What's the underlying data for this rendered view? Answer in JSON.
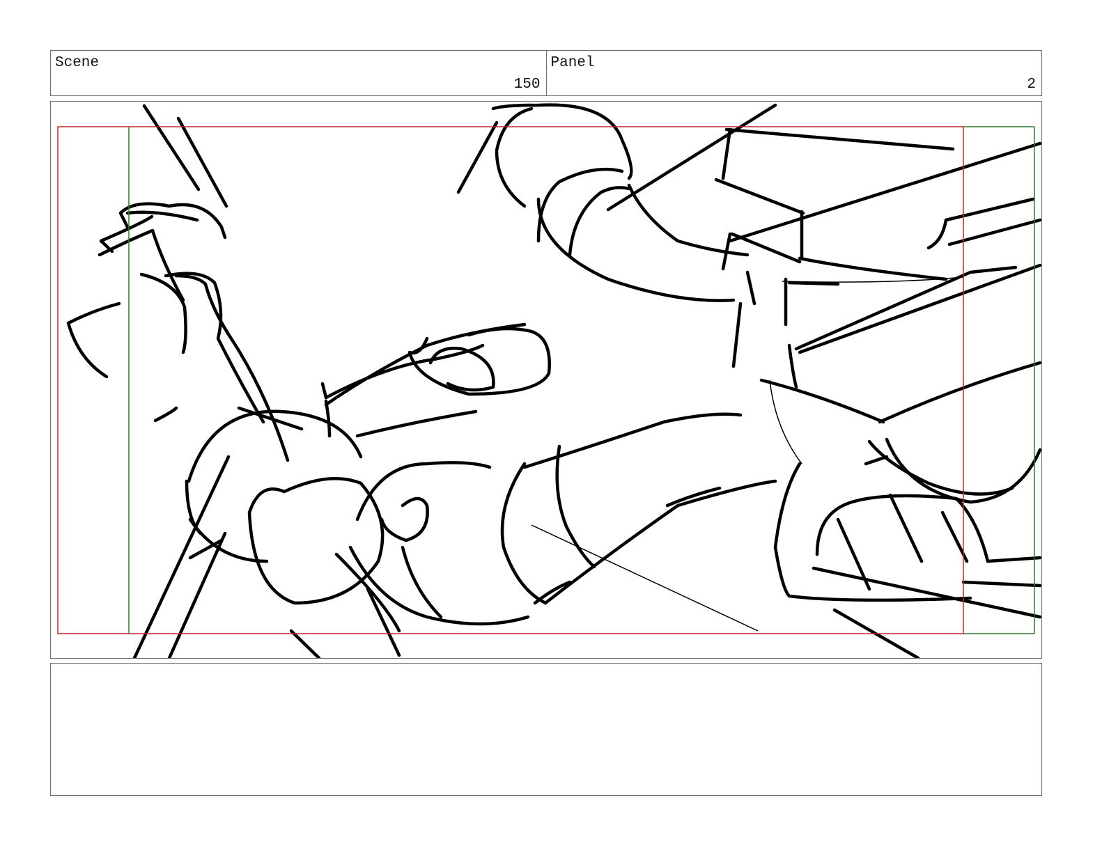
{
  "header": {
    "scene": {
      "label": "Scene",
      "value": "150"
    },
    "panel": {
      "label": "Panel",
      "value": "2"
    }
  },
  "frame": {
    "safe_area_color": "#c0282d",
    "action_area_color": "#2d7d2d",
    "sketch_color": "#000000"
  },
  "notes": {
    "text": ""
  }
}
